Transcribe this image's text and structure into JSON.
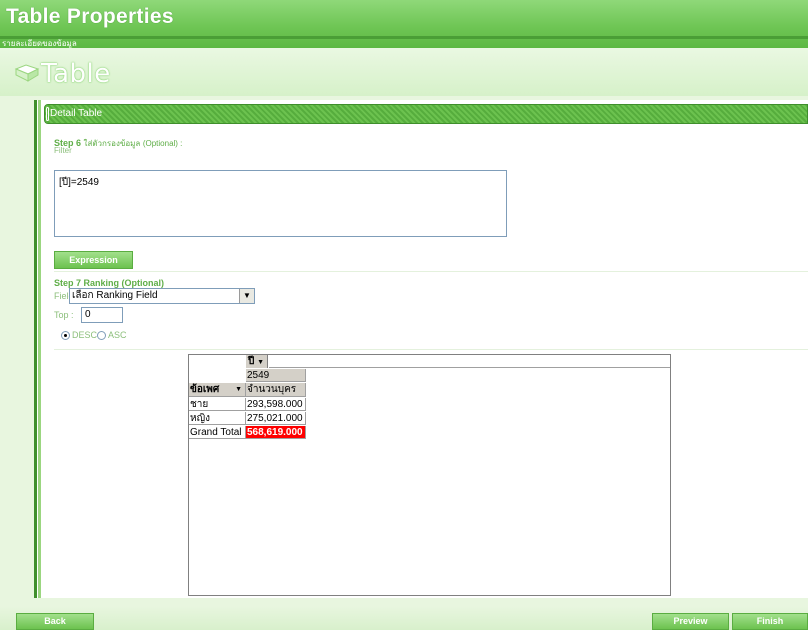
{
  "header": {
    "title": "Table Properties",
    "subtitle": "รายละเอียดของข้อมูล"
  },
  "banner": {
    "heading": "Table",
    "icon": "table-book-icon"
  },
  "detail": {
    "bar_label": "Detail Table"
  },
  "step6": {
    "title": "Step 6",
    "title_thai": "ใส่ตัวกรองข้อมูล",
    "optional": "(Optional) :",
    "sub": "Filter",
    "filter_value": "[ปี]=2549",
    "expression_button": "Expression"
  },
  "step7": {
    "title": "Step 7 Ranking (Optional)",
    "field_label": "Field :",
    "field_value": "เลือก Ranking Field",
    "top_label": "Top :",
    "top_value": "0",
    "radio_desc": "DESC",
    "radio_asc": "ASC",
    "selected": "DESC"
  },
  "pivot": {
    "column_field": "ปี",
    "row_field": "ข้อเพศ",
    "year": "2549",
    "measure": "จำนวนบุคร",
    "rows": [
      {
        "label": "ชาย",
        "value": "293,598.000"
      },
      {
        "label": "หญิง",
        "value": "275,021.000"
      }
    ],
    "grand_total_label": "Grand Total",
    "grand_total_value": "568,619.000",
    "dropdown_glyph": "▼"
  },
  "footer": {
    "back": "Back",
    "preview": "Preview",
    "finish": "Finish"
  },
  "colors": {
    "brand_green": "#6fc655",
    "dark_green": "#3f8f2c",
    "grand_total_bg": "#ff0000"
  }
}
